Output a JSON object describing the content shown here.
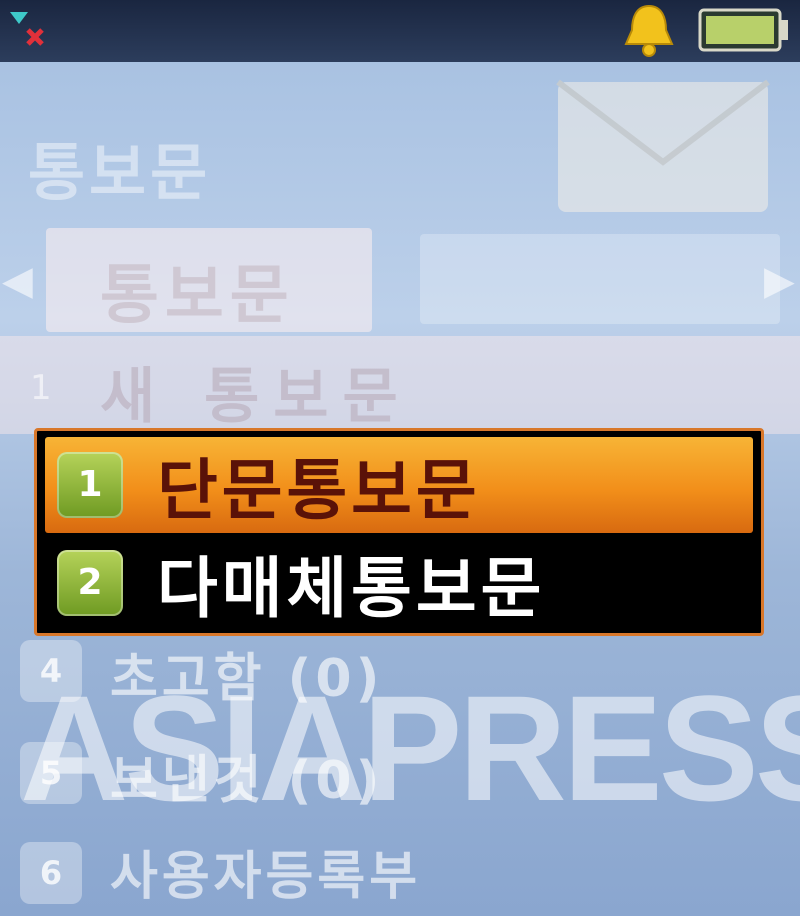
{
  "status_bar": {
    "icons": [
      "signal-off-icon",
      "bell-icon",
      "battery-icon"
    ],
    "battery_color": "#b8d06a"
  },
  "background_screen": {
    "title": "통보문",
    "tab_label": "통보문",
    "row_label": "새 통보문",
    "row_number": "1",
    "items": [
      {
        "number": "4",
        "label": "초고함 (0)"
      },
      {
        "number": "5",
        "label": "보낸것 (0)"
      },
      {
        "number": "6",
        "label": "사용자등록부"
      }
    ]
  },
  "popup_menu": {
    "items": [
      {
        "number": "1",
        "label": "단문통보문",
        "selected": true
      },
      {
        "number": "2",
        "label": "다매체통보문",
        "selected": false
      }
    ],
    "colors": {
      "highlight": "#f28f1a",
      "border": "#d8772a",
      "badge": "#8cb43a",
      "background": "#000000"
    }
  },
  "watermark": "ASIAPRESS"
}
